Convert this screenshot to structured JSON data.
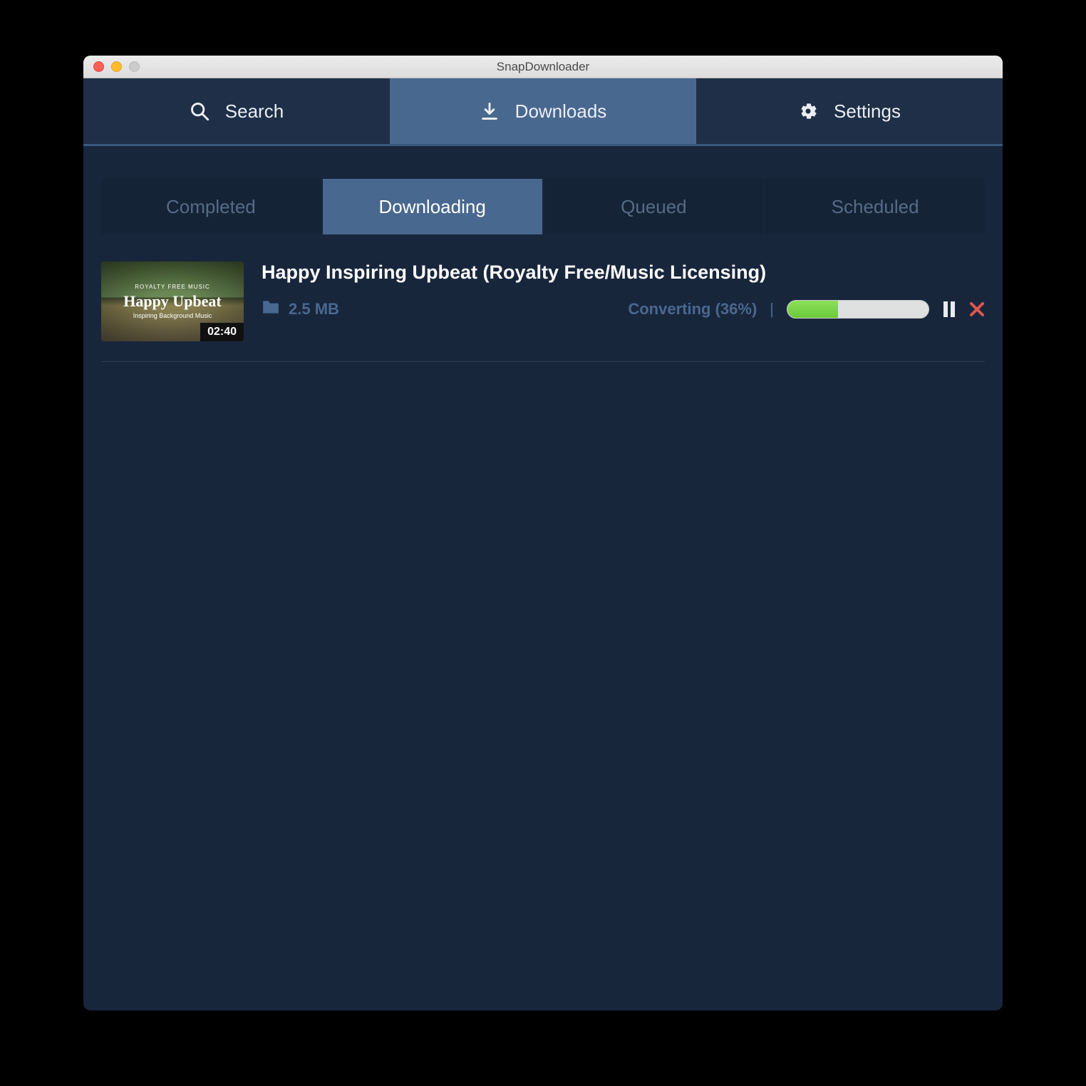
{
  "window_title": "SnapDownloader",
  "nav": {
    "search": "Search",
    "downloads": "Downloads",
    "settings": "Settings"
  },
  "subtabs": {
    "completed": "Completed",
    "downloading": "Downloading",
    "queued": "Queued",
    "scheduled": "Scheduled"
  },
  "item": {
    "title": "Happy Inspiring Upbeat (Royalty Free/Music Licensing)",
    "size": "2.5 MB",
    "status": "Converting (36%)",
    "duration": "02:40",
    "thumb_super": "ROYALTY FREE MUSIC",
    "thumb_title": "Happy Upbeat",
    "thumb_sub": "Inspiring Background Music",
    "progress_percent": 36
  }
}
